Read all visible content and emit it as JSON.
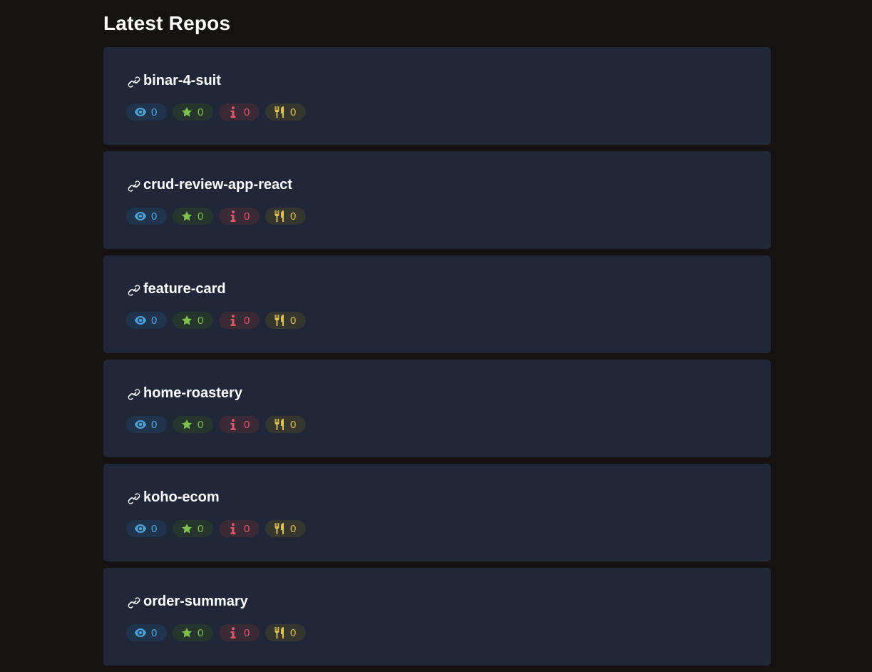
{
  "page": {
    "title": "Latest Repos"
  },
  "colors": {
    "background": "#161211",
    "card": "#1f2738",
    "watch": "#4fa6e3",
    "star": "#7ec24a",
    "issue": "#e0566a",
    "fork": "#e2c14a"
  },
  "badge_icons": [
    "eye-icon",
    "star-icon",
    "info-icon",
    "utensils-icon"
  ],
  "repos": [
    {
      "name": "binar-4-suit",
      "watchers": "0",
      "stars": "0",
      "issues": "0",
      "forks": "0"
    },
    {
      "name": "crud-review-app-react",
      "watchers": "0",
      "stars": "0",
      "issues": "0",
      "forks": "0"
    },
    {
      "name": "feature-card",
      "watchers": "0",
      "stars": "0",
      "issues": "0",
      "forks": "0"
    },
    {
      "name": "home-roastery",
      "watchers": "0",
      "stars": "0",
      "issues": "0",
      "forks": "0"
    },
    {
      "name": "koho-ecom",
      "watchers": "0",
      "stars": "0",
      "issues": "0",
      "forks": "0"
    },
    {
      "name": "order-summary",
      "watchers": "0",
      "stars": "0",
      "issues": "0",
      "forks": "0"
    }
  ]
}
